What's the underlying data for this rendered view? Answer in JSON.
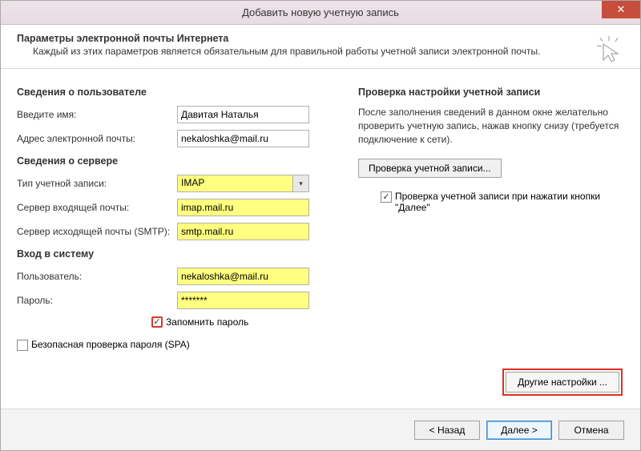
{
  "title": "Добавить новую учетную запись",
  "header": {
    "title": "Параметры электронной почты Интернета",
    "sub": "Каждый из этих параметров является обязательным для правильной работы учетной записи электронной почты."
  },
  "left": {
    "user_section": "Сведения о пользователе",
    "name_label": "Введите имя:",
    "name_value": "Давитая Наталья",
    "email_label": "Адрес электронной почты:",
    "email_value": "nekaloshka@mail.ru",
    "server_section": "Сведения о сервере",
    "account_type_label": "Тип учетной записи:",
    "account_type_value": "IMAP",
    "incoming_label": "Сервер входящей почты:",
    "incoming_value": "imap.mail.ru",
    "outgoing_label": "Сервер исходящей почты (SMTP):",
    "outgoing_value": "smtp.mail.ru",
    "login_section": "Вход в систему",
    "user_label": "Пользователь:",
    "user_value": "nekaloshka@mail.ru",
    "password_label": "Пароль:",
    "password_value": "*******",
    "remember_label": "Запомнить пароль",
    "remember_checked": true,
    "spa_label": "Безопасная проверка пароля (SPA)",
    "spa_checked": false
  },
  "right": {
    "section": "Проверка настройки учетной записи",
    "desc": "После заполнения сведений в данном окне желательно проверить учетную запись, нажав кнопку снизу (требуется подключение к сети).",
    "test_btn": "Проверка учетной записи...",
    "auto_test_label": "Проверка учетной записи при нажатии кнопки \"Далее\"",
    "auto_test_checked": true,
    "more_btn": "Другие настройки ..."
  },
  "footer": {
    "back": "< Назад",
    "next": "Далее >",
    "cancel": "Отмена"
  }
}
